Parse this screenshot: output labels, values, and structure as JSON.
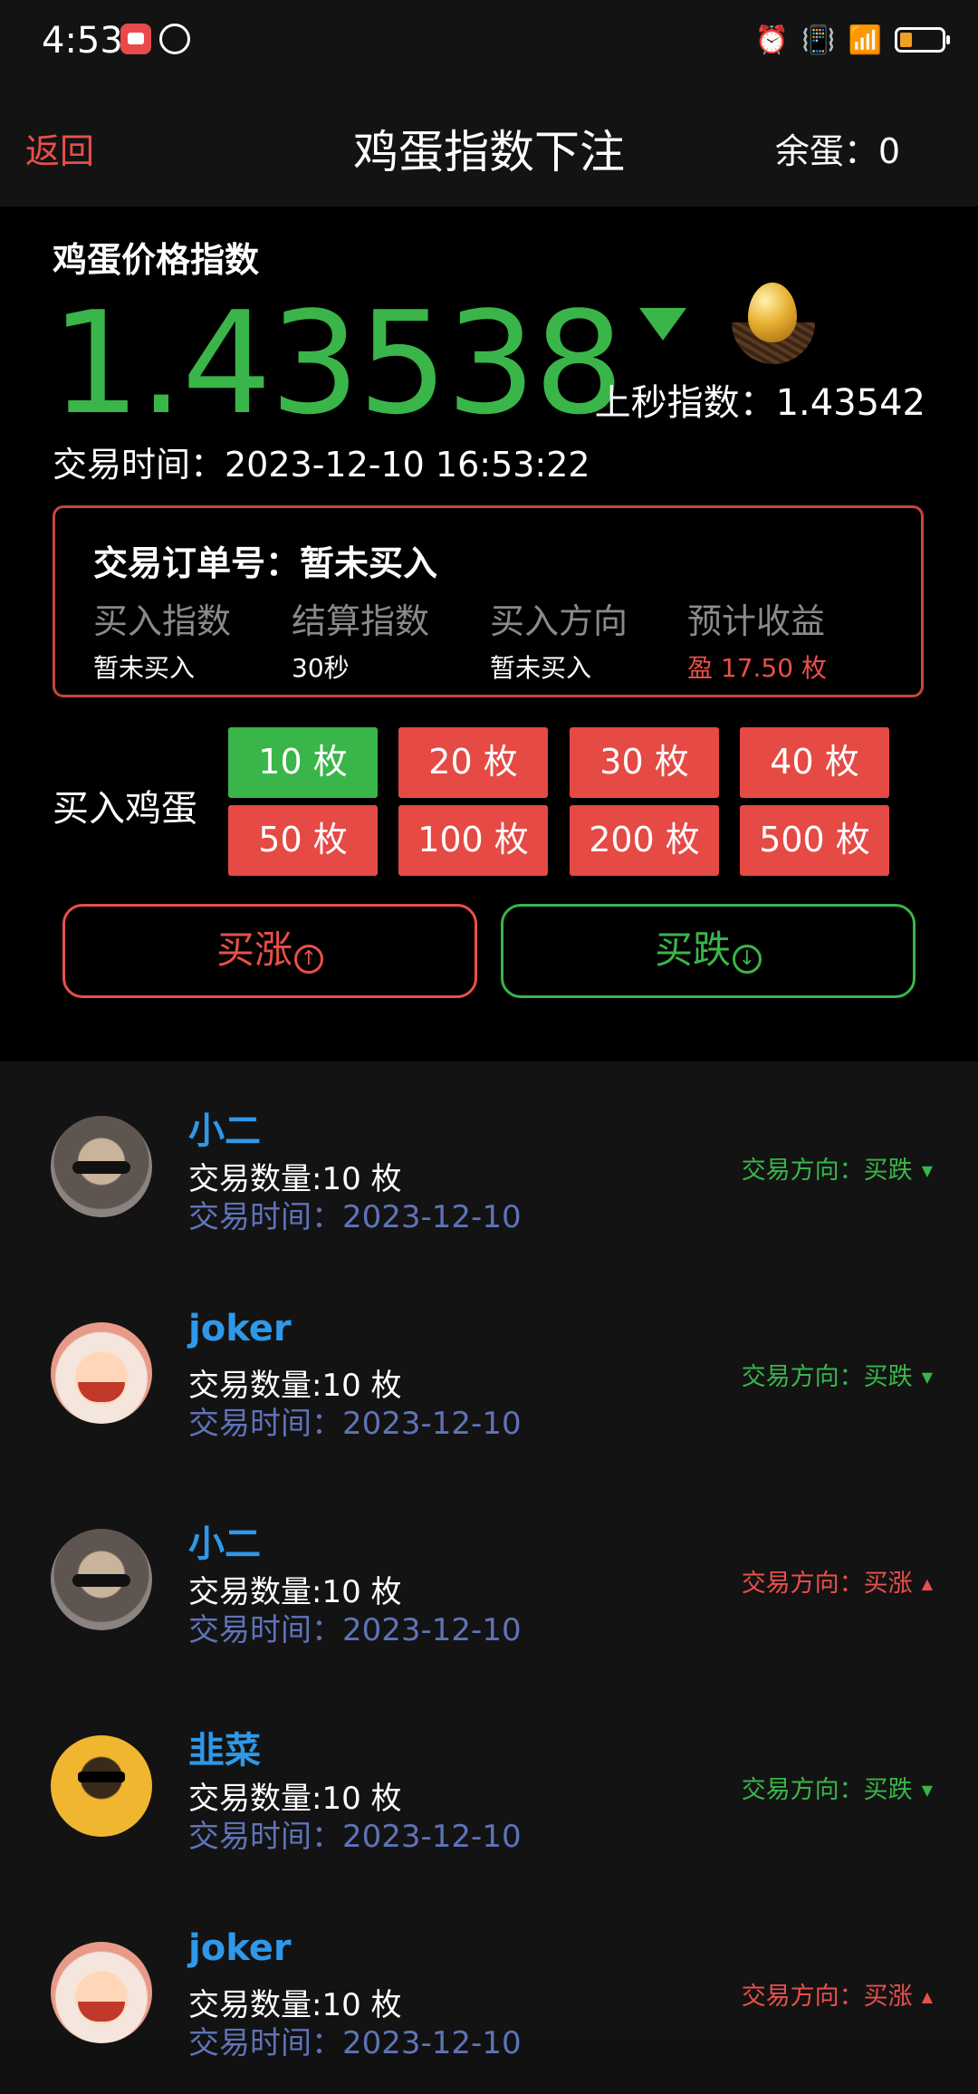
{
  "status_bar": {
    "time": "4:53"
  },
  "header": {
    "back": "返回",
    "title": "鸡蛋指数下注",
    "balance": "余蛋：0"
  },
  "index": {
    "title": "鸡蛋价格指数",
    "value": "1.43538",
    "prev_label": "上秒指数：1.43542",
    "trade_time": "交易时间：2023-12-10 16:53:22",
    "trend": "down"
  },
  "order": {
    "title": "交易订单号：暂未买入",
    "columns": [
      {
        "header": "买入指数",
        "value": "暂未买入"
      },
      {
        "header": "结算指数",
        "value": "30秒"
      },
      {
        "header": "买入方向",
        "value": "暂未买入"
      },
      {
        "header": "预计收益",
        "value": "盈 17.50 枚"
      }
    ]
  },
  "buy": {
    "label": "买入鸡蛋",
    "options": [
      "10 枚",
      "20 枚",
      "30 枚",
      "40 枚",
      "50 枚",
      "100 枚",
      "200 枚",
      "500 枚"
    ],
    "selected": "10 枚",
    "up_label": "买涨",
    "down_label": "买跌"
  },
  "colors": {
    "green": "#3ab549",
    "red": "#e94f4a",
    "blue": "#2f98e8"
  },
  "trades": [
    {
      "name": "小二",
      "qty": "交易数量:10 枚",
      "time": "交易时间：2023-12-10",
      "direction": "交易方向：买跌",
      "avatar": "bear-avatar"
    },
    {
      "name": "joker",
      "qty": "交易数量:10 枚",
      "time": "交易时间：2023-12-10",
      "direction": "交易方向：买跌",
      "avatar": "kid-avatar"
    },
    {
      "name": "小二",
      "qty": "交易数量:10 枚",
      "time": "交易时间：2023-12-10",
      "direction": "交易方向：买涨",
      "avatar": "bear-avatar"
    },
    {
      "name": "韭菜",
      "qty": "交易数量:10 枚",
      "time": "交易时间：2023-12-10",
      "direction": "交易方向：买跌",
      "avatar": "man-avatar"
    },
    {
      "name": "joker",
      "qty": "交易数量:10 枚",
      "time": "交易时间：2023-12-10",
      "direction": "交易方向：买涨",
      "avatar": "kid-avatar"
    }
  ]
}
